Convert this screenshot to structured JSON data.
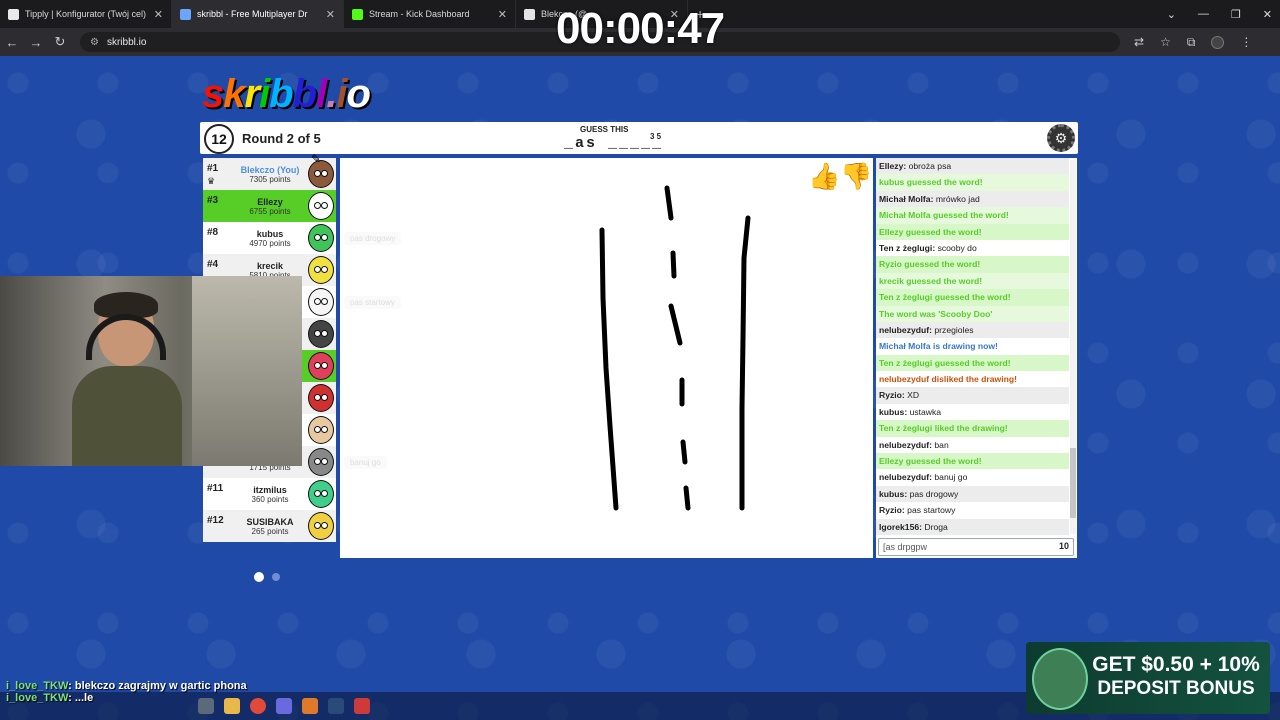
{
  "browser": {
    "tabs": [
      {
        "title": "Tipply | Konfigurator (Twój cel)",
        "color": "#e9e9e9",
        "active": false
      },
      {
        "title": "skribbl - Free Multiplayer Dr",
        "color": "#6aa6ff",
        "active": true
      },
      {
        "title": "Stream - Kick Dashboard",
        "color": "#53fc18",
        "active": false
      },
      {
        "title": "Blekczo (@...",
        "color": "#e4e4e4",
        "active": false
      }
    ],
    "url": "skribbl.io"
  },
  "stream_timer": "00:00:47",
  "logo": {
    "text": "skribbl.io",
    "colors": [
      "#ef130b",
      "#ff7100",
      "#ffe400",
      "#00cc00",
      "#00b2ff",
      "#231fd3",
      "#a300ba",
      "#d37caa",
      "#a0522d",
      "#ffffff"
    ]
  },
  "header": {
    "timer": "12",
    "round": "Round 2 of 5",
    "guess_label": "GUESS THIS",
    "word_hint": "_as _____",
    "word_lengths": "3 5"
  },
  "players": [
    {
      "rank": "#1",
      "name": "Blekczo (You)",
      "points": "7305 points",
      "you": true,
      "avatar": "#8a5a3a",
      "style": "alt"
    },
    {
      "rank": "#3",
      "name": "Ellezy",
      "points": "6755 points",
      "you": false,
      "avatar": "#ffffff",
      "style": "hl"
    },
    {
      "rank": "#8",
      "name": "kubus",
      "points": "4970 points",
      "you": false,
      "avatar": "#3fc45a",
      "style": ""
    },
    {
      "rank": "#4",
      "name": "krecik",
      "points": "5810 points",
      "you": false,
      "avatar": "#f0e040",
      "style": "alt"
    },
    {
      "rank": "",
      "name": "",
      "points": "",
      "you": false,
      "avatar": "#f5f5f5",
      "style": ""
    },
    {
      "rank": "",
      "name": "",
      "points": "",
      "you": false,
      "avatar": "#444444",
      "style": "alt"
    },
    {
      "rank": "",
      "name": "",
      "points": "",
      "you": false,
      "avatar": "#e0405a",
      "style": "hl"
    },
    {
      "rank": "",
      "name": "",
      "points": "",
      "you": false,
      "avatar": "#d03030",
      "style": "alt"
    },
    {
      "rank": "",
      "name": "",
      "points": "",
      "you": false,
      "avatar": "#e8c8a0",
      "style": ""
    },
    {
      "rank": "",
      "name": "",
      "points": "1715 points",
      "you": false,
      "avatar": "#888888",
      "style": "alt"
    },
    {
      "rank": "#11",
      "name": "itzmilus",
      "points": "360 points",
      "you": false,
      "avatar": "#3fcf8a",
      "style": ""
    },
    {
      "rank": "#12",
      "name": "SUSIBAKA",
      "points": "265 points",
      "you": false,
      "avatar": "#f0d040",
      "style": "alt"
    }
  ],
  "canvas_ghosts": [
    "pas drogowy",
    "pas startowy",
    "banuj go"
  ],
  "chat": [
    {
      "who": "Ellezy",
      "text": "obroża psa",
      "type": "msg"
    },
    {
      "who": "",
      "text": "kubus guessed the word!",
      "type": "guess"
    },
    {
      "who": "Michał Molfa",
      "text": "mrówko jad",
      "type": "msg"
    },
    {
      "who": "",
      "text": "Michał Molfa guessed the word!",
      "type": "guess"
    },
    {
      "who": "",
      "text": "Ellezy guessed the word!",
      "type": "guess"
    },
    {
      "who": "Ten z żeglugi",
      "text": "scooby do",
      "type": "msg"
    },
    {
      "who": "",
      "text": "Ryzio guessed the word!",
      "type": "guess"
    },
    {
      "who": "",
      "text": "krecik guessed the word!",
      "type": "guess"
    },
    {
      "who": "",
      "text": "Ten z żeglugi guessed the word!",
      "type": "guess"
    },
    {
      "who": "",
      "text": "The word was 'Scooby Doo'",
      "type": "guess"
    },
    {
      "who": "nelubezyduf",
      "text": "przegioles",
      "type": "msg"
    },
    {
      "who": "",
      "text": "Michał Molfa is drawing now!",
      "type": "info"
    },
    {
      "who": "",
      "text": "Ten z żeglugi guessed the word!",
      "type": "guess"
    },
    {
      "who": "",
      "text": "nelubezyduf disliked the drawing!",
      "type": "warn"
    },
    {
      "who": "Ryzio",
      "text": "XD",
      "type": "msg"
    },
    {
      "who": "kubus",
      "text": "ustawka",
      "type": "msg"
    },
    {
      "who": "",
      "text": "Ten z żeglugi liked the drawing!",
      "type": "guess"
    },
    {
      "who": "nelubezyduf",
      "text": "ban",
      "type": "msg"
    },
    {
      "who": "",
      "text": "Ellezy guessed the word!",
      "type": "guess"
    },
    {
      "who": "nelubezyduf",
      "text": "banuj go",
      "type": "msg"
    },
    {
      "who": "kubus",
      "text": "pas drogowy",
      "type": "msg"
    },
    {
      "who": "Ryzio",
      "text": "pas startowy",
      "type": "msg"
    },
    {
      "who": "Igorek156",
      "text": "Droga",
      "type": "msg"
    }
  ],
  "chat_input": {
    "value": "[as drpgpw",
    "count": "10"
  },
  "stream_chat": [
    {
      "user": "i_love_TKW",
      "text": ": blekczo zagrajmy w gartic phona"
    },
    {
      "user": "i_love_TKW",
      "text": ": ...le"
    }
  ],
  "ad": {
    "line1": "GET $0.50 + 10%",
    "line2": "DEPOSIT BONUS"
  }
}
